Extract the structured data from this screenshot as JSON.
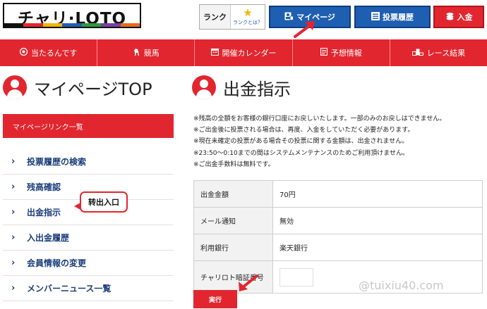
{
  "header": {
    "logo_text": "チャリ·LOTO",
    "rank_label": "ランク",
    "rank_link": "ランクとは？",
    "mypage_button": "マイページ",
    "history_button": "投票履歴",
    "deposit_button": "入金"
  },
  "logo_stripe_colors": [
    "#111111",
    "#e2262f",
    "#f5b400",
    "#1e5fb1",
    "#2c9a3c",
    "#7a3fa0",
    "#e86a1a"
  ],
  "nav": {
    "items": [
      {
        "label": "当たるんです",
        "icon": "target-icon"
      },
      {
        "label": "競馬",
        "icon": "horse-icon"
      },
      {
        "label": "開催カレンダー",
        "icon": "calendar-icon"
      },
      {
        "label": "予想情報",
        "icon": "document-icon"
      },
      {
        "label": "レース結果",
        "icon": "podium-icon"
      }
    ]
  },
  "titles": {
    "left": "マイページTOP",
    "right": "出金指示"
  },
  "sidebar": {
    "heading": "マイページリンク一覧",
    "items": [
      {
        "label": "投票履歴の検索"
      },
      {
        "label": "残高確認"
      },
      {
        "label": "出金指示"
      },
      {
        "label": "入出金履歴"
      },
      {
        "label": "会員情報の変更"
      },
      {
        "label": "メンバーニュース一覧"
      }
    ]
  },
  "callout": "转出入口",
  "notices": [
    "※残高の全額をお客様の銀行口座にお戻しいたします。一部のみのお戻しはできません。",
    "※ご出金後に投票される場合は、再度、入金をしていただく必要があります。",
    "※現在未確定の投票がある場合その投票に関する金額は、出金されません。",
    "※23:50〜0:10までの間はシステムメンテナンスのためご利用頂けません。",
    "※ご出金手数料は無料です。"
  ],
  "form": {
    "rows": [
      {
        "label": "出金金額",
        "value": "70円"
      },
      {
        "label": "メール通知",
        "value": "無効"
      },
      {
        "label": "利用銀行",
        "value": "楽天銀行"
      }
    ],
    "pin_label": "チャリロト暗証番号",
    "pin_value": ""
  },
  "execute_button": "実行",
  "watermark": "@tuixiu40.com",
  "colors": {
    "brand_red": "#e2262f",
    "brand_blue": "#1e5fb1",
    "link_navy": "#1a3c7a"
  }
}
